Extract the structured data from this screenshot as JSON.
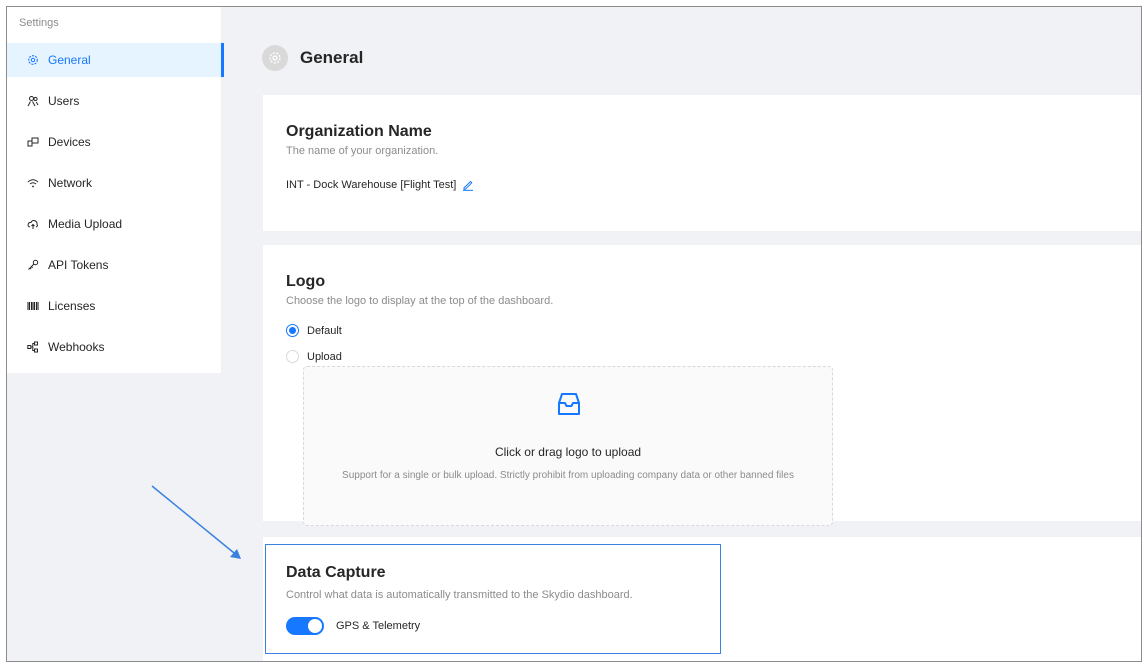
{
  "sidebar": {
    "title": "Settings",
    "items": [
      {
        "label": "General",
        "icon": "gear-icon",
        "active": true
      },
      {
        "label": "Users",
        "icon": "users-icon"
      },
      {
        "label": "Devices",
        "icon": "devices-icon"
      },
      {
        "label": "Network",
        "icon": "wifi-icon"
      },
      {
        "label": "Media Upload",
        "icon": "cloud-upload-icon"
      },
      {
        "label": "API Tokens",
        "icon": "key-icon"
      },
      {
        "label": "Licenses",
        "icon": "barcode-icon"
      },
      {
        "label": "Webhooks",
        "icon": "webhook-icon"
      }
    ]
  },
  "header": {
    "title": "General",
    "icon": "gear-icon"
  },
  "org": {
    "title": "Organization Name",
    "description": "The name of your organization.",
    "value": "INT - Dock Warehouse [Flight Test]"
  },
  "logo": {
    "title": "Logo",
    "description": "Choose the logo to display at the top of the dashboard.",
    "options": [
      {
        "label": "Default",
        "checked": true
      },
      {
        "label": "Upload",
        "checked": false
      }
    ],
    "dropzone": {
      "text": "Click or drag logo to upload",
      "hint": "Support for a single or bulk upload. Strictly prohibit from uploading company data or other banned files"
    }
  },
  "data_capture": {
    "title": "Data Capture",
    "description": "Control what data is automatically transmitted to the Skydio dashboard.",
    "toggle_label": "GPS & Telemetry",
    "toggle_on": true
  },
  "colors": {
    "accent": "#1677ff",
    "annotation": "#3b82e0"
  }
}
